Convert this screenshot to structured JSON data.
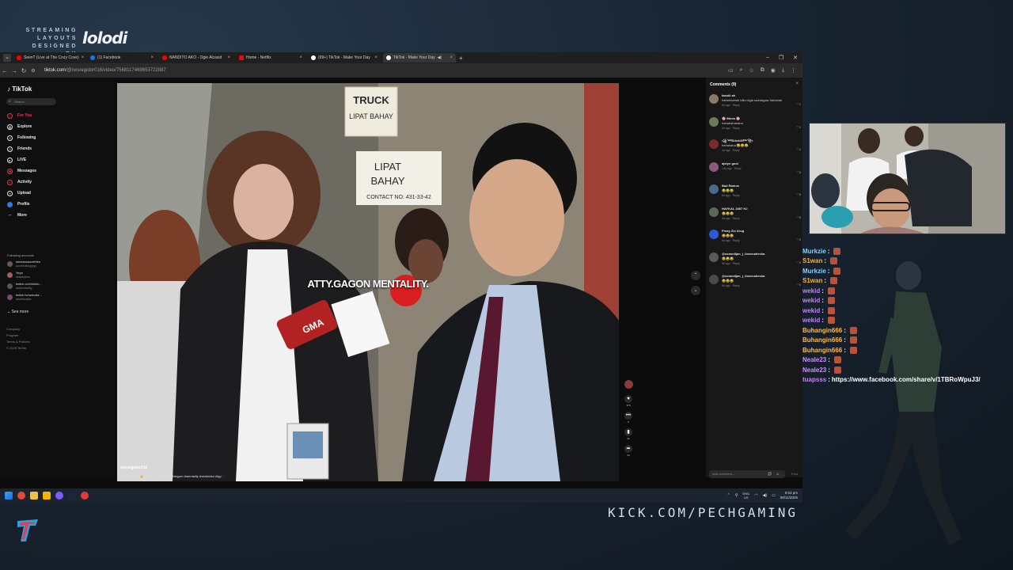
{
  "overlay": {
    "brand_text": "STREAMING LAYOUTS DESIGNED BY",
    "brand_logo": "lolodi",
    "kick_url": "KICK.COM/PECHGAMING",
    "corner_logo_icon": "pech-logo-icon"
  },
  "browser": {
    "tabs": [
      {
        "label": "Seen? (Live at The Cozy Cove)",
        "color": "#ff0000",
        "active": false
      },
      {
        "label": "(1) Facebook",
        "color": "#1877f2",
        "active": false
      },
      {
        "label": "NANDITO AKO - Ogie Alcasid",
        "color": "#ff0000",
        "active": false
      },
      {
        "label": "Home - Netflix",
        "color": "#e50914",
        "active": false
      },
      {
        "label": "(99+) TikTok - Make Your Day",
        "color": "#ffffff",
        "active": false
      },
      {
        "label": "TikTok - Make Your Day",
        "color": "#ffffff",
        "active": true
      }
    ],
    "new_tab": "+",
    "url_host": "tiktok.com",
    "url_path": "/@nesregidor016/video/7568117469653722887"
  },
  "tiktok": {
    "logo": "TikTok",
    "search_placeholder": "Search",
    "nav": [
      {
        "label": "For You",
        "icon": "home-icon",
        "active": true
      },
      {
        "label": "Explore",
        "icon": "compass-icon",
        "active": false
      },
      {
        "label": "Following",
        "icon": "following-icon",
        "active": false
      },
      {
        "label": "Friends",
        "icon": "friends-icon",
        "active": false
      },
      {
        "label": "LIVE",
        "icon": "live-icon",
        "active": false
      },
      {
        "label": "Messages",
        "icon": "messages-icon",
        "active": false
      },
      {
        "label": "Activity",
        "icon": "bell-icon",
        "active": false
      },
      {
        "label": "Upload",
        "icon": "upload-icon",
        "active": false
      },
      {
        "label": "Profile",
        "icon": "profile-icon",
        "active": false
      },
      {
        "label": "More",
        "icon": "more-icon",
        "active": false
      }
    ],
    "following_title": "Following accounts",
    "following": [
      {
        "name": "ukessesaucefries",
        "sub": "ucvetoboyyyyy"
      },
      {
        "name": "Yeya",
        "sub": "iwantcites"
      },
      {
        "name": "twitch.com/shido...",
        "sub": "shidomonty"
      },
      {
        "name": "twitch.tv/owsoda...",
        "sub": "owothodas"
      }
    ],
    "see_more": "See more",
    "footer": [
      "Company",
      "Program",
      "Terms & Policies",
      "© 2025 TikTok"
    ]
  },
  "video": {
    "caption": "ATTY.GAGON MENTALITY.",
    "username": "nesregidor016",
    "description": "jeron Michael ✌ funny moment #bubblegum #mentality #viralvideo #fyp ·",
    "progress": 0.28,
    "actions": [
      {
        "icon": "heart-icon",
        "count": "379"
      },
      {
        "icon": "comment-icon",
        "count": "9"
      },
      {
        "icon": "bookmark-icon",
        "count": "41"
      },
      {
        "icon": "share-icon",
        "count": "34"
      }
    ],
    "nav_up": "⌃",
    "nav_down": "⌄"
  },
  "comments": {
    "title": "Comments (9)",
    "items": [
      {
        "name": "tassiii ah",
        "text": "hahahhahah bilis bigla sumisigaw hahahah",
        "time": "5d ago",
        "reply": "Reply",
        "likes": "1"
      },
      {
        "name": "🌸 fibros 🌸",
        "text": "hahahahahaha",
        "time": "4d ago",
        "reply": "Reply",
        "likes": "1"
      },
      {
        "name": "꧁༺Drbrld0༻꧂",
        "text": "hahahaha 😂😂😂",
        "time": "4d ago",
        "reply": "Reply",
        "likes": "1"
      },
      {
        "name": "ajelyn gool",
        "text": "",
        "time": "14h ago",
        "reply": "Reply",
        "likes": "0"
      },
      {
        "name": "Bad Ramos",
        "text": "😂😂😂",
        "time": "5d ago",
        "reply": "Reply",
        "likes": "0"
      },
      {
        "name": "HAYKAL 2857 HJ",
        "text": "😂😂😂",
        "time": "5d ago",
        "reply": "Reply",
        "likes": "0"
      },
      {
        "name": "Pinay Zlo Arug",
        "text": "😂😂😂",
        "time": "5d ago",
        "reply": "Reply",
        "likes": "0"
      },
      {
        "name": "@comedljan_j_ilovecahesha",
        "text": "😂😂😂",
        "time": "5d ago",
        "reply": "Reply",
        "likes": "0"
      },
      {
        "name": "@comedljan_j_ilovecahesha",
        "text": "😂😂😂",
        "time": "5d ago",
        "reply": "Reply",
        "likes": "0"
      }
    ],
    "input_placeholder": "Add comment...",
    "post": "Post"
  },
  "taskbar": {
    "lang_top": "ENG",
    "lang_bottom": "US",
    "time": "8:53 pm",
    "date": "08/11/2025"
  },
  "chat": [
    {
      "user": "Murkzie",
      "color": "#7fd3ff",
      "msg": ""
    },
    {
      "user": "S1wan",
      "color": "#ffb020",
      "msg": ""
    },
    {
      "user": "Murkzie",
      "color": "#7fd3ff",
      "msg": ""
    },
    {
      "user": "S1wan",
      "color": "#ffb020",
      "msg": ""
    },
    {
      "user": "wekid",
      "color": "#c77dff",
      "msg": ""
    },
    {
      "user": "wekid",
      "color": "#c77dff",
      "msg": ""
    },
    {
      "user": "wekid",
      "color": "#c77dff",
      "msg": ""
    },
    {
      "user": "wekid",
      "color": "#c77dff",
      "msg": ""
    },
    {
      "user": "Buhangin666",
      "color": "#ffb84d",
      "msg": ""
    },
    {
      "user": "Buhangin666",
      "color": "#ffb84d",
      "msg": ""
    },
    {
      "user": "Buhangin666",
      "color": "#ffb84d",
      "msg": ""
    },
    {
      "user": "Neale23",
      "color": "#d08bff",
      "msg": ""
    },
    {
      "user": "Neale23",
      "color": "#d08bff",
      "msg": ""
    },
    {
      "user": "tuapsss",
      "color": "#c77dff",
      "msg": "https://www.facebook.com/share/v/1TBRoWpuJ3/"
    }
  ]
}
